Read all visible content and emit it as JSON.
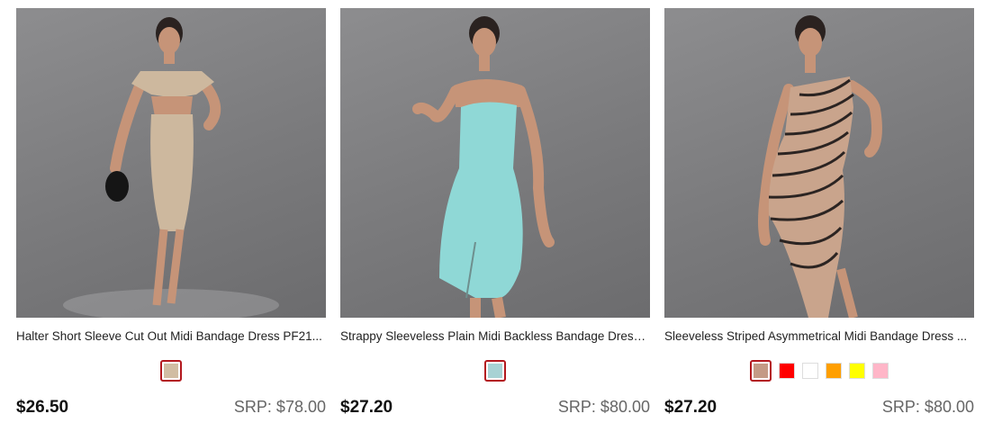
{
  "products": [
    {
      "title": "Halter Short Sleeve Cut Out Midi Bandage Dress PF21...",
      "price": "$26.50",
      "srp": "SRP: $78.00",
      "dress_color": "#cdb89e",
      "swatches": [
        "#d1bda3"
      ],
      "selected_swatch": 0
    },
    {
      "title": "Strappy Sleeveless Plain Midi Backless Bandage Dress ...",
      "price": "$27.20",
      "srp": "SRP: $80.00",
      "dress_color": "#8fd8d6",
      "swatches": [
        "#a8d2d4"
      ],
      "selected_swatch": 0
    },
    {
      "title": "Sleeveless Striped Asymmetrical Midi Bandage Dress ...",
      "price": "$27.20",
      "srp": "SRP: $80.00",
      "dress_color": "#c9a48c",
      "swatches": [
        "#c49a85",
        "#ff0000",
        "#ffffff",
        "#ff9f00",
        "#ffff00",
        "#ffb6c8"
      ],
      "selected_swatch": 0
    }
  ]
}
